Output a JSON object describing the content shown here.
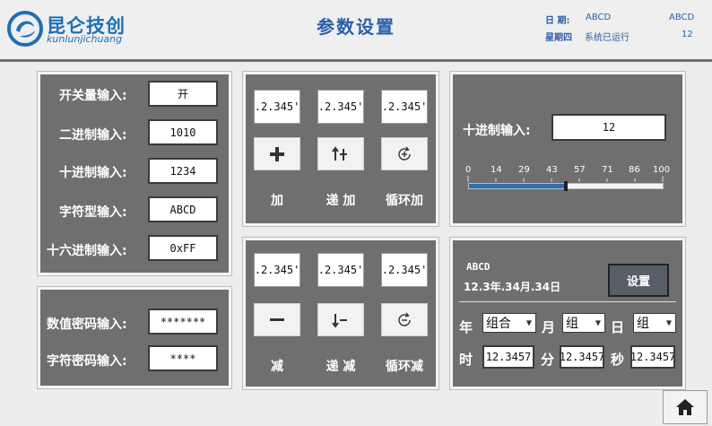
{
  "header": {
    "logo_cn": "昆仑技创",
    "logo_en": "kunlunjichuang",
    "title": "参数设置",
    "date_label": "日 期:",
    "date_value": "ABCD",
    "date_right": "ABCD",
    "weekday_label": "星期四",
    "runtime_label": "系统已运行",
    "runtime_value": "12"
  },
  "inputs": {
    "switch_label": "开关量输入:",
    "switch_value": "开",
    "binary_label": "二进制输入:",
    "binary_value": "1010",
    "decimal_label": "十进制输入:",
    "decimal_value": "1234",
    "string_label": "字符型输入:",
    "string_value": "ABCD",
    "hex_label": "十六进制输入:",
    "hex_value": "0xFF"
  },
  "passwords": {
    "numeric_label": "数值密码输入:",
    "numeric_value": "*******",
    "string_label": "字符密码输入:",
    "string_value": "****"
  },
  "ops_top": {
    "values": [
      ".2.345'",
      ".2.345'",
      ".2.345'"
    ],
    "captions": [
      "加",
      "递 加",
      "循环加"
    ]
  },
  "ops_bottom": {
    "values": [
      ".2.345'",
      ".2.345'",
      ".2.345'"
    ],
    "captions": [
      "减",
      "递 减",
      "循环减"
    ]
  },
  "slider": {
    "label": "十进制输入:",
    "value": "12",
    "ticks": [
      "0",
      "14",
      "29",
      "43",
      "57",
      "71",
      "86",
      "100"
    ],
    "level_percent": 50
  },
  "datetime": {
    "line1": "ABCD",
    "line2": "12.3年.34月.34日",
    "set_button": "设置",
    "year_label": "年",
    "year_value": "组合",
    "month_label": "月",
    "month_value": "组",
    "day_label": "日",
    "day_value": "组",
    "hour_label": "时",
    "hour_value": "12.3457",
    "minute_label": "分",
    "minute_value": "12.3457",
    "second_label": "秒",
    "second_value": "12.3457"
  },
  "colors": {
    "panel": "#6f6f6f",
    "brand": "#1e6fb5",
    "title": "#2b5fa8",
    "slider_fill": "#2f6db5"
  }
}
